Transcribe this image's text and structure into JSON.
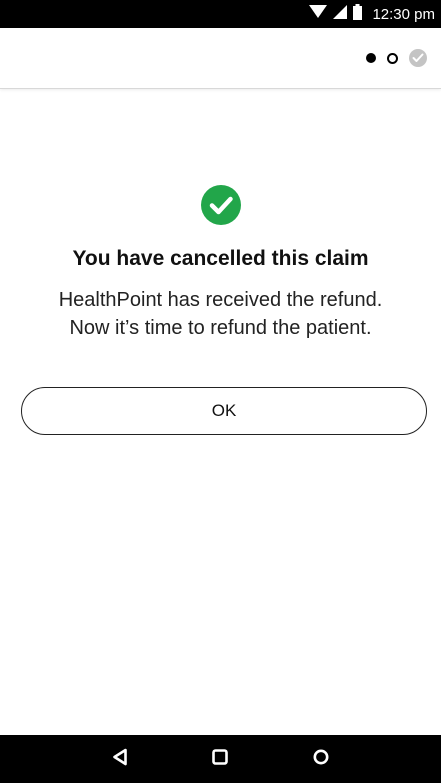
{
  "status_bar": {
    "time": "12:30 pm",
    "icons": [
      "wifi-icon",
      "signal-icon",
      "battery-icon"
    ]
  },
  "header": {
    "steps": [
      {
        "state": "current",
        "icon": "step-filled-dot"
      },
      {
        "state": "upcoming",
        "icon": "step-empty-dot"
      },
      {
        "state": "complete",
        "icon": "check-icon"
      }
    ]
  },
  "main": {
    "icon": "check-circle-icon",
    "title": "You have cancelled this claim",
    "message_line1": "HealthPoint has received the refund.",
    "message_line2": "Now it’s time to refund the patient.",
    "ok_label": "OK"
  },
  "nav_bar": {
    "buttons": [
      "back-icon",
      "home-icon",
      "recents-icon"
    ]
  },
  "colors": {
    "success": "#22a64a",
    "step_complete": "#c4c4c4",
    "bars": "#000000"
  }
}
